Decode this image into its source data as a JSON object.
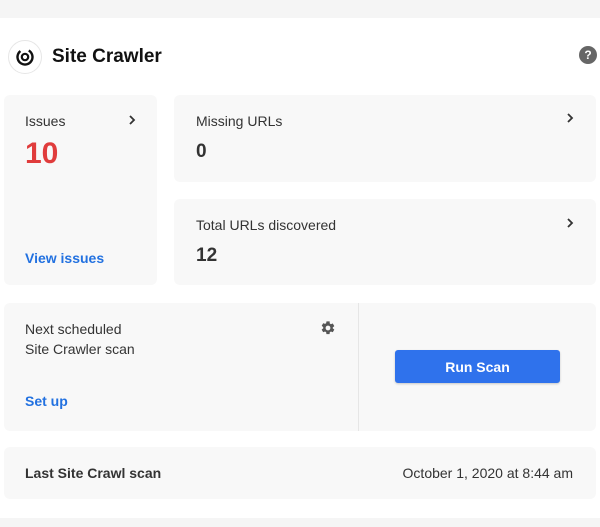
{
  "header": {
    "title": "Site Crawler",
    "help_label": "?"
  },
  "issues": {
    "label": "Issues",
    "value": "10",
    "link": "View issues"
  },
  "missing": {
    "label": "Missing URLs",
    "value": "0"
  },
  "total": {
    "label": "Total URLs discovered",
    "value": "12"
  },
  "schedule": {
    "line1": "Next scheduled",
    "line2": "Site Crawler scan",
    "link": "Set up"
  },
  "run": {
    "label": "Run Scan"
  },
  "last": {
    "label": "Last Site Crawl scan",
    "date": "October 1, 2020 at 8:44 am"
  },
  "colors": {
    "accent": "#2f72ec",
    "link": "#2271e0",
    "alert": "#e03c3c"
  }
}
